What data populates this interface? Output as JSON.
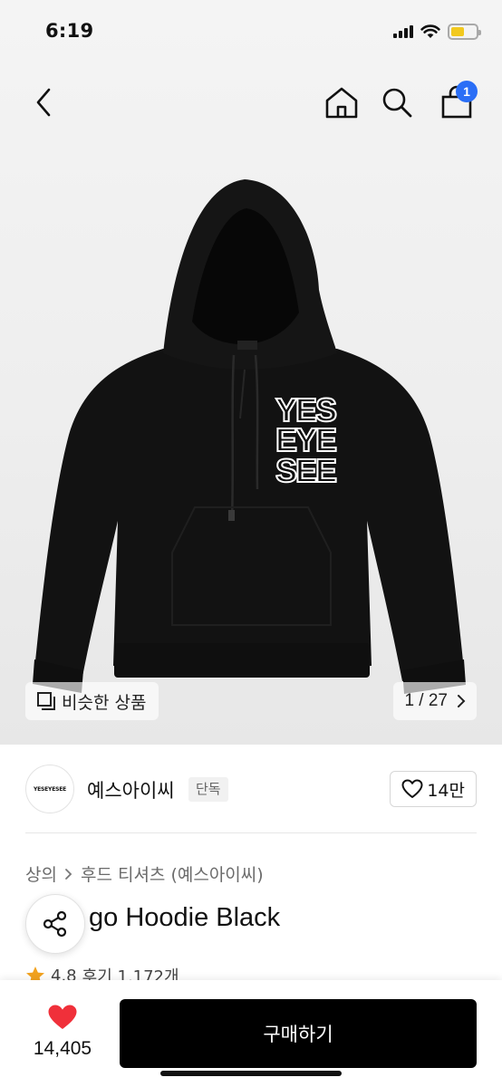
{
  "status_bar": {
    "time": "6:19"
  },
  "nav": {
    "cart_count": "1",
    "badge_color": "#2a6ef6"
  },
  "product_print": {
    "lines": [
      "YES",
      "EYE",
      "SEE"
    ]
  },
  "gallery": {
    "similar_label": "비슷한 상품",
    "counter": "1 / 27"
  },
  "brand": {
    "logo_text": "YESEYESEE",
    "name": "예스아이씨",
    "tag": "단독",
    "likes": "14만"
  },
  "breadcrumb": {
    "items": [
      "상의",
      "후드 티셔츠 (예스아이씨)"
    ]
  },
  "product": {
    "title": "go Hoodie Black",
    "rating": "4.8",
    "reviews": "후기 1,172개"
  },
  "bottom_bar": {
    "wish_count": "14,405",
    "buy_label": "구매하기",
    "heart_color": "#f0303a"
  }
}
